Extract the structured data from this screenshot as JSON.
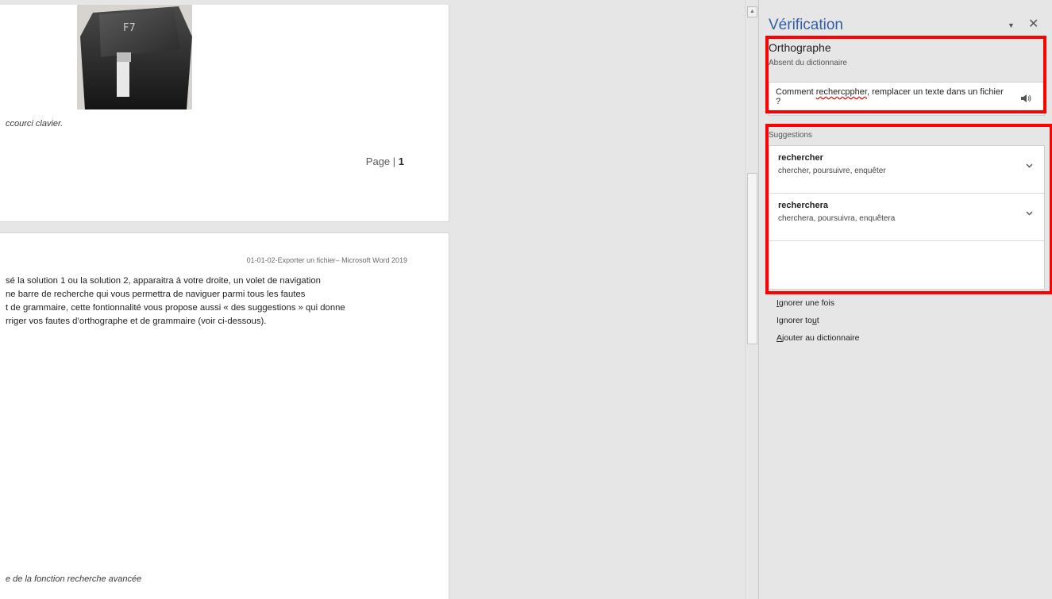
{
  "document": {
    "page1": {
      "key_label": "F7",
      "caption": "ccourci clavier.",
      "page_number_prefix": "Page | ",
      "page_number": "1"
    },
    "page2": {
      "header": "01-01-02-Exporter un fichier– Microsoft Word 2019",
      "lines": [
        "sé la solution 1 ou la solution 2, apparaitra à votre droite, un volet de navigation",
        "ne barre de recherche qui vous permettra de naviguer parmi tous les fautes",
        "t de grammaire, cette fontionnalité vous propose aussi «  des suggestions » qui donne",
        "rriger vos fautes d’orthographe et de grammaire (voir ci-dessous)."
      ],
      "caption": "e de la fonction recherche avancée"
    }
  },
  "pane": {
    "title": "Vérification",
    "orthography": {
      "title": "Orthographe",
      "subtitle": "Absent du dictionnaire",
      "context_before": "Comment ",
      "context_error": "rechercppher",
      "context_after": ", remplacer un texte dans un fichier ?"
    },
    "suggestions_label": "Suggestions",
    "suggestions": [
      {
        "word": "rechercher",
        "synonyms": "chercher, poursuivre, enquêter"
      },
      {
        "word": "recherchera",
        "synonyms": "cherchera, poursuivra, enquêtera"
      }
    ],
    "actions": {
      "ignore_once_key": "I",
      "ignore_once_rest": "gnorer une fois",
      "ignore_all_pre": "Ignorer to",
      "ignore_all_key": "u",
      "ignore_all_post": "t",
      "add_key": "A",
      "add_rest": "jouter au dictionnaire"
    }
  },
  "colors": {
    "title_blue": "#2e5fa8",
    "highlight_red": "#ff0000",
    "spell_error_red": "#d00000"
  },
  "icons": [
    "speaker-icon",
    "chevron-down-icon",
    "dropdown-arrow-icon",
    "close-icon",
    "scroll-up-arrow-icon"
  ]
}
